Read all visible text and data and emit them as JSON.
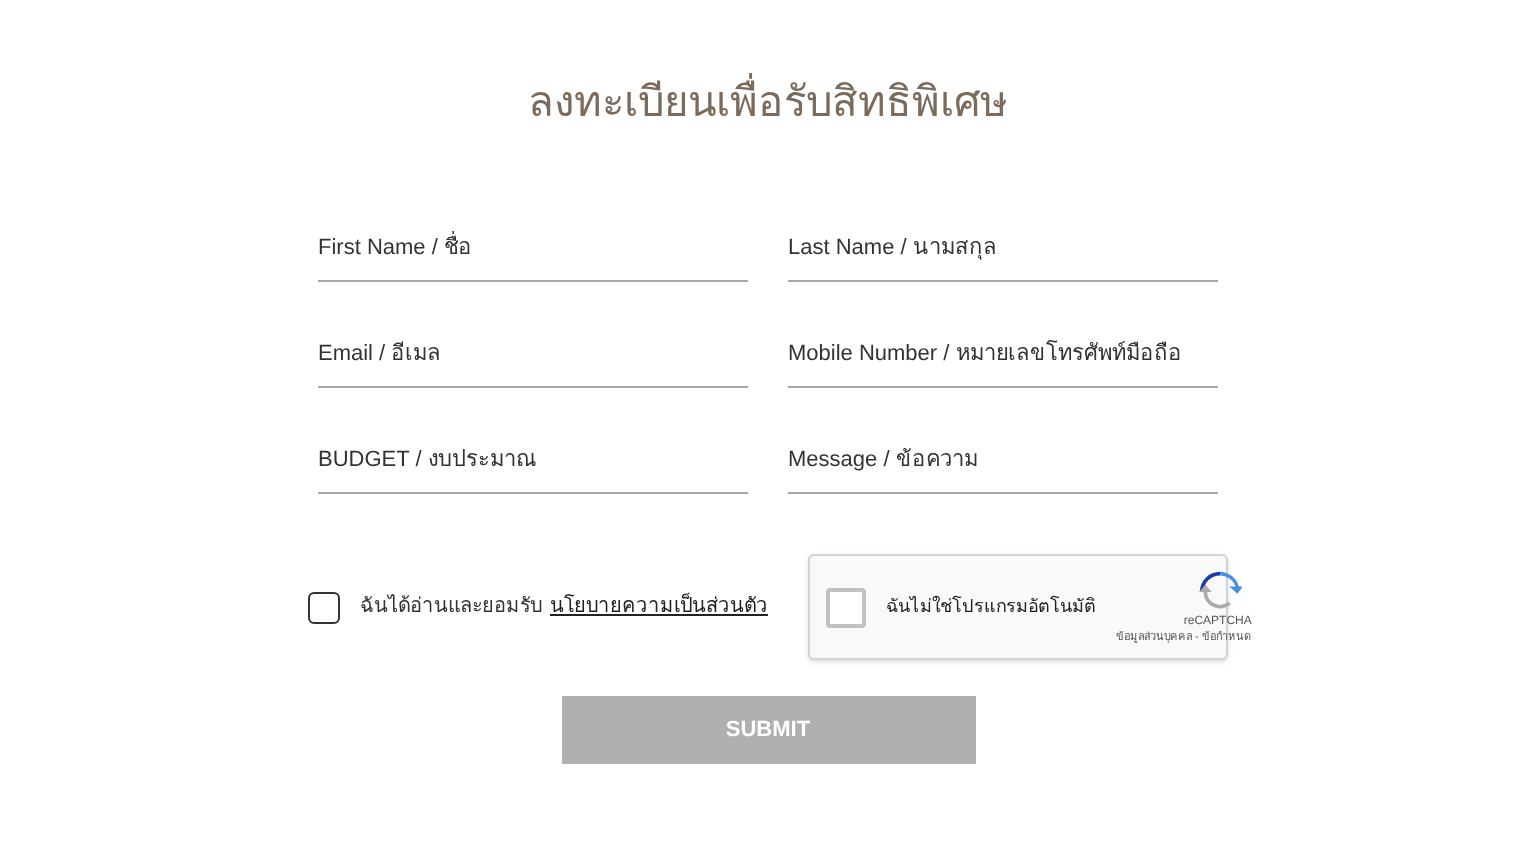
{
  "title": "ลงทะเบียนเพื่อรับสิทธิพิเศษ",
  "fields": [
    {
      "placeholder": "First Name / ชื่อ"
    },
    {
      "placeholder": "Last Name / นามสกุล"
    },
    {
      "placeholder": "Email / อีเมล"
    },
    {
      "placeholder": "Mobile Number / หมายเลขโทรศัพท์มือถือ"
    },
    {
      "placeholder": "BUDGET / งบประมาณ"
    },
    {
      "placeholder": "Message / ข้อความ"
    }
  ],
  "consent": {
    "checked": false,
    "text": "ฉันได้อ่านและยอมรับ",
    "link": "นโยบายความเป็นส่วนตัว"
  },
  "captcha": {
    "checked": false,
    "label": "ฉันไม่ใช่โปรแกรมอัตโนมัติ",
    "brand": "reCAPTCHA",
    "links": "ข้อมูลส่วนบุคคล - ข้อกำหนด"
  },
  "submit": "SUBMIT"
}
